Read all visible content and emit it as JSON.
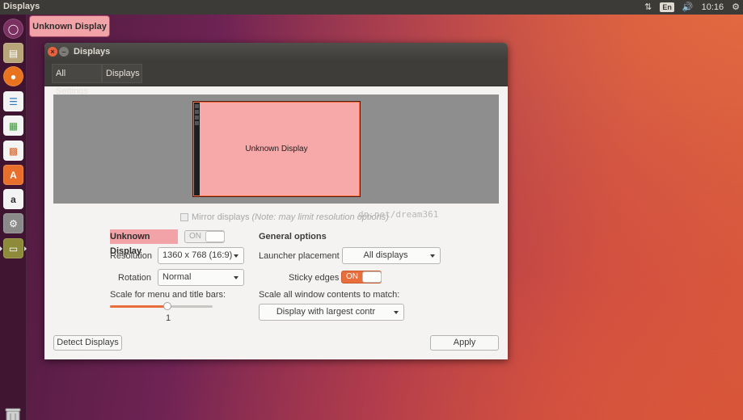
{
  "top_panel": {
    "title": "Displays",
    "keyboard_layout": "En",
    "time": "10:16",
    "icons": [
      "network-arrows-icon",
      "volume-icon",
      "gear-icon"
    ]
  },
  "launcher": {
    "tooltip": "Unknown Display",
    "items": [
      {
        "name": "ubuntu-dash-icon",
        "color": "#6b2a55"
      },
      {
        "name": "files-icon",
        "color": "#b8a57a"
      },
      {
        "name": "firefox-icon",
        "color": "#e8731f"
      },
      {
        "name": "libreoffice-writer-icon",
        "color": "#2d7cc1"
      },
      {
        "name": "libreoffice-calc-icon",
        "color": "#3e9b3a"
      },
      {
        "name": "libreoffice-impress-icon",
        "color": "#d6642a"
      },
      {
        "name": "software-center-icon",
        "color": "#e76f2b"
      },
      {
        "name": "amazon-icon",
        "color": "#2f2f2f"
      },
      {
        "name": "system-settings-icon",
        "color": "#8a8a8a"
      },
      {
        "name": "displays-settings-icon",
        "color": "#8d8a3a"
      }
    ],
    "trash_icon": "trash-icon"
  },
  "window": {
    "title": "Displays",
    "nav": {
      "all_settings": "All Settings",
      "displays": "Displays"
    },
    "monitor_label": "Unknown Display",
    "mirror": {
      "label": "Mirror displays",
      "note": "(Note: may limit resolution options)"
    },
    "watermark": "dn.net/dream361",
    "left": {
      "display_name": "Unknown Display",
      "display_switch": "ON",
      "resolution_label": "Resolution",
      "resolution_value": "1360 x 768 (16:9)",
      "rotation_label": "Rotation",
      "rotation_value": "Normal",
      "scale_label": "Scale for menu and title bars:",
      "scale_value": "1",
      "scale_fraction": 0.56
    },
    "right": {
      "heading": "General options",
      "launcher_label": "Launcher placement",
      "launcher_value": "All displays",
      "sticky_label": "Sticky edges",
      "sticky_state": "ON",
      "scale_all_label": "Scale all window contents to match:",
      "scale_all_value": "Display with largest contr"
    },
    "detect_button": "Detect Displays",
    "apply_button": "Apply"
  },
  "colors": {
    "accent": "#e86e3c",
    "monitor_fill": "#f7a9a9",
    "highlight": "#f2a3a8"
  }
}
